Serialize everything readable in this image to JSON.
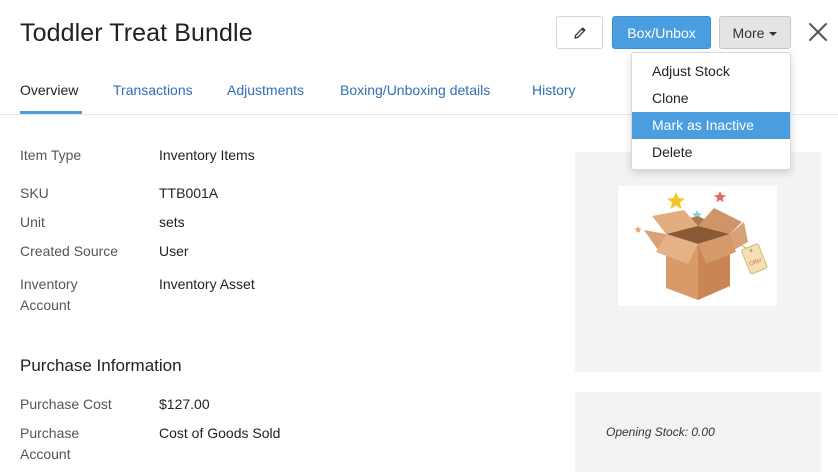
{
  "header": {
    "title": "Toddler Treat Bundle",
    "box_button_label": "Box/Unbox",
    "more_button_label": "More"
  },
  "tabs": [
    {
      "label": "Overview",
      "active": true
    },
    {
      "label": "Transactions",
      "active": false
    },
    {
      "label": "Adjustments",
      "active": false
    },
    {
      "label": "Boxing/Unboxing details",
      "active": false
    },
    {
      "label": "History",
      "active": false
    }
  ],
  "more_menu": {
    "items": [
      "Adjust Stock",
      "Clone",
      "Mark as Inactive",
      "Delete"
    ],
    "highlighted": "Mark as Inactive"
  },
  "details": {
    "item_type_label": "Item Type",
    "item_type_value": "Inventory Items",
    "sku_label": "SKU",
    "sku_value": "TTB001A",
    "unit_label": "Unit",
    "unit_value": "sets",
    "created_source_label": "Created Source",
    "created_source_value": "User",
    "inventory_account_label": "Inventory Account",
    "inventory_account_value": "Inventory Asset"
  },
  "purchase": {
    "section_title": "Purchase Information",
    "cost_label": "Purchase Cost",
    "cost_value": "$127.00",
    "account_label": "Purchase Account",
    "account_value": "Cost of Goods Sold"
  },
  "stock": {
    "opening_stock_text": "Opening Stock: 0.00"
  },
  "image": {
    "tag_text": "Offer"
  },
  "colors": {
    "accent": "#4a9ee0",
    "link": "#2f6fb3",
    "panel_bg": "#f3f3f3"
  }
}
